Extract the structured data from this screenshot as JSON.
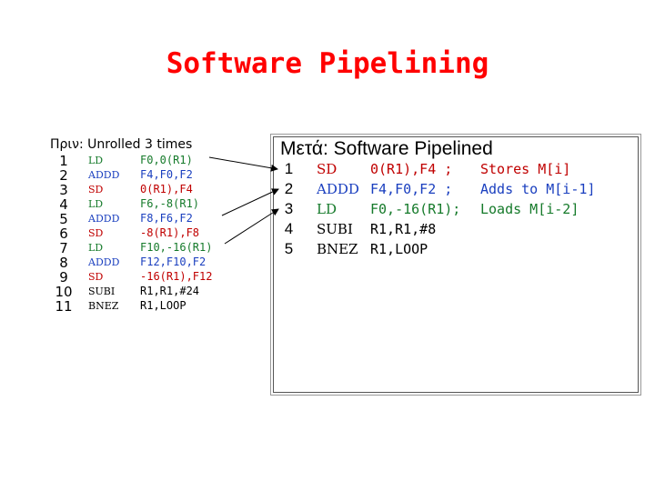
{
  "title": "Software Pipelining",
  "before": {
    "heading": "Πριν: Unrolled 3 times",
    "rows": [
      {
        "num": "1",
        "op": "LD",
        "args": "F0,0(R1)"
      },
      {
        "num": "2",
        "op": "ADDD",
        "args": "F4,F0,F2"
      },
      {
        "num": "3",
        "op": "SD",
        "args": "0(R1),F4"
      },
      {
        "num": "4",
        "op": "LD",
        "args": "F6,-8(R1)"
      },
      {
        "num": "5",
        "op": "ADDD",
        "args": "F8,F6,F2"
      },
      {
        "num": "6",
        "op": "SD",
        "args": "-8(R1),F8"
      },
      {
        "num": "7",
        "op": "LD",
        "args": "F10,-16(R1)"
      },
      {
        "num": "8",
        "op": "ADDD",
        "args": "F12,F10,F2"
      },
      {
        "num": "9",
        "op": "SD",
        "args": "-16(R1),F12"
      },
      {
        "num": "10",
        "op": "SUBI",
        "args": "R1,R1,#24"
      },
      {
        "num": "11",
        "op": "BNEZ",
        "args": "R1,LOOP"
      }
    ]
  },
  "after": {
    "heading": "Μετά: Software Pipelined",
    "rows": [
      {
        "num": "1",
        "op": "SD",
        "args": "0(R1),F4 ;",
        "comment": "Stores M[i]"
      },
      {
        "num": "2",
        "op": "ADDD",
        "args": "F4,F0,F2 ;",
        "comment": "Adds to M[i-1]"
      },
      {
        "num": "3",
        "op": "LD",
        "args": "F0,-16(R1);",
        "comment": "Loads M[i-2]"
      },
      {
        "num": "4",
        "op": "SUBI",
        "args": "R1,R1,#8",
        "comment": ""
      },
      {
        "num": "5",
        "op": "BNEZ",
        "args": "R1,LOOP",
        "comment": ""
      }
    ]
  },
  "colors": {
    "title": "#ff0000",
    "blue": "#1a3fbf",
    "green": "#157a2a",
    "red": "#c00000"
  }
}
